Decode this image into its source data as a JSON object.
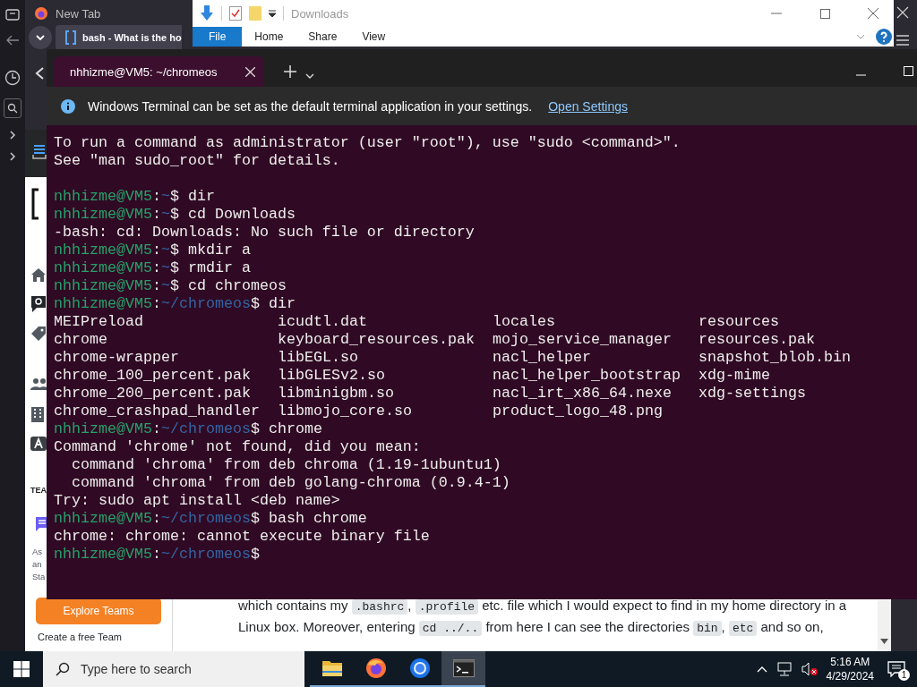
{
  "browser": {
    "tabs": [
      {
        "title": "New Tab",
        "selected": false
      },
      {
        "title": "bash - What is the ho",
        "selected": true
      }
    ],
    "page": {
      "nav_label": "TEA",
      "promo_lines": [
        "As",
        "an",
        "Sta"
      ],
      "explore_button": "Explore Teams",
      "create_link": "Create a free Team",
      "paragraph": [
        [
          {
            "text": "which contains my ",
            "code": false
          },
          {
            "text": ".bashrc",
            "code": true
          },
          {
            "text": ", ",
            "code": false
          },
          {
            "text": ".profile",
            "code": true
          },
          {
            "text": " etc. file which I would expect to find in my home directory in a",
            "code": false
          }
        ],
        [
          {
            "text": "Linux box. Moreover, entering ",
            "code": false
          },
          {
            "text": "cd ../..",
            "code": true
          },
          {
            "text": " from here I can see the directories ",
            "code": false
          },
          {
            "text": "bin",
            "code": true
          },
          {
            "text": ", ",
            "code": false
          },
          {
            "text": "etc",
            "code": true
          },
          {
            "text": " and so on,",
            "code": false
          }
        ]
      ]
    }
  },
  "explorer": {
    "title": "Downloads",
    "ribbon_tabs": [
      {
        "label": "File",
        "selected": true
      },
      {
        "label": "Home",
        "selected": false
      },
      {
        "label": "Share",
        "selected": false
      },
      {
        "label": "View",
        "selected": false
      }
    ]
  },
  "terminal": {
    "tab_title": "nhhizme@VM5: ~/chromeos",
    "info": {
      "message": "Windows Terminal can be set as the default terminal application in your settings.",
      "link": "Open Settings"
    },
    "lines": [
      {
        "kind": "output",
        "text": "To run a command as administrator (user \"root\"), use \"sudo <command>\"."
      },
      {
        "kind": "output",
        "text": "See \"man sudo_root\" for details."
      },
      {
        "kind": "blank"
      },
      {
        "kind": "prompt",
        "user": "nhhizme@VM5",
        "sep": ":",
        "path": "~",
        "symbol": "$",
        "command": "dir"
      },
      {
        "kind": "prompt",
        "user": "nhhizme@VM5",
        "sep": ":",
        "path": "~",
        "symbol": "$",
        "command": "cd Downloads"
      },
      {
        "kind": "output",
        "text": "-bash: cd: Downloads: No such file or directory"
      },
      {
        "kind": "prompt",
        "user": "nhhizme@VM5",
        "sep": ":",
        "path": "~",
        "symbol": "$",
        "command": "mkdir a"
      },
      {
        "kind": "prompt",
        "user": "nhhizme@VM5",
        "sep": ":",
        "path": "~",
        "symbol": "$",
        "command": "rmdir a"
      },
      {
        "kind": "prompt",
        "user": "nhhizme@VM5",
        "sep": ":",
        "path": "~",
        "symbol": "$",
        "command": "cd chromeos"
      },
      {
        "kind": "prompt",
        "user": "nhhizme@VM5",
        "sep": ":",
        "path": "~/chromeos",
        "symbol": "$",
        "command": "dir"
      },
      {
        "kind": "listing",
        "cells": [
          "MEIPreload",
          "icudtl.dat",
          "locales",
          "resources"
        ]
      },
      {
        "kind": "listing",
        "cells": [
          "chrome",
          "keyboard_resources.pak",
          "mojo_service_manager",
          "resources.pak"
        ]
      },
      {
        "kind": "listing",
        "cells": [
          "chrome-wrapper",
          "libEGL.so",
          "nacl_helper",
          "snapshot_blob.bin"
        ]
      },
      {
        "kind": "listing",
        "cells": [
          "chrome_100_percent.pak",
          "libGLESv2.so",
          "nacl_helper_bootstrap",
          "xdg-mime"
        ]
      },
      {
        "kind": "listing",
        "cells": [
          "chrome_200_percent.pak",
          "libminigbm.so",
          "nacl_irt_x86_64.nexe",
          "xdg-settings"
        ]
      },
      {
        "kind": "listing",
        "cells": [
          "chrome_crashpad_handler",
          "libmojo_core.so",
          "product_logo_48.png"
        ]
      },
      {
        "kind": "prompt",
        "user": "nhhizme@VM5",
        "sep": ":",
        "path": "~/chromeos",
        "symbol": "$",
        "command": "chrome"
      },
      {
        "kind": "output",
        "text": "Command 'chrome' not found, did you mean:"
      },
      {
        "kind": "output",
        "text": "  command 'chroma' from deb chroma (1.19-1ubuntu1)"
      },
      {
        "kind": "output",
        "text": "  command 'chroma' from deb golang-chroma (0.9.4-1)"
      },
      {
        "kind": "output",
        "text": "Try: sudo apt install <deb name>"
      },
      {
        "kind": "prompt",
        "user": "nhhizme@VM5",
        "sep": ":",
        "path": "~/chromeos",
        "symbol": "$",
        "command": "bash chrome"
      },
      {
        "kind": "output",
        "text": "chrome: chrome: cannot execute binary file"
      },
      {
        "kind": "prompt",
        "user": "nhhizme@VM5",
        "sep": ":",
        "path": "~/chromeos",
        "symbol": "$"
      }
    ]
  },
  "taskbar": {
    "search_placeholder": "Type here to search",
    "apps": [
      {
        "kind": "folder",
        "selected": false
      },
      {
        "kind": "firefox",
        "selected": false
      },
      {
        "kind": "chrome",
        "selected": false
      },
      {
        "kind": "terminal",
        "selected": true
      }
    ],
    "time": "5:16 AM",
    "date": "4/29/2024",
    "notification_count": "1"
  }
}
